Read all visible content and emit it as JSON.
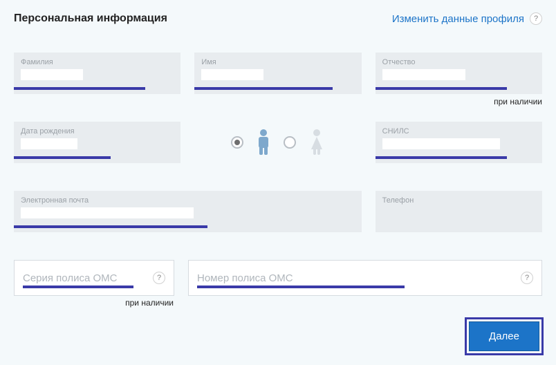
{
  "header": {
    "title": "Персональная информация",
    "edit_link": "Изменить данные профиля",
    "help": "?"
  },
  "fields": {
    "surname": {
      "label": "Фамилия"
    },
    "name": {
      "label": "Имя"
    },
    "patronymic": {
      "label": "Отчество",
      "hint": "при наличии"
    },
    "birthdate": {
      "label": "Дата рождения"
    },
    "snils": {
      "label": "СНИЛС"
    },
    "email": {
      "label": "Электронная почта"
    },
    "phone": {
      "label": "Телефон"
    }
  },
  "gender": {
    "male_selected": true,
    "female_selected": false
  },
  "oms": {
    "series_placeholder": "Серия полиса ОМС",
    "number_placeholder": "Номер полиса ОМС",
    "hint": "при наличии",
    "help": "?"
  },
  "buttons": {
    "next": "Далее"
  },
  "colors": {
    "accent": "#3a3aa8",
    "link": "#1c74c8",
    "button_bg": "#1c74c8"
  }
}
